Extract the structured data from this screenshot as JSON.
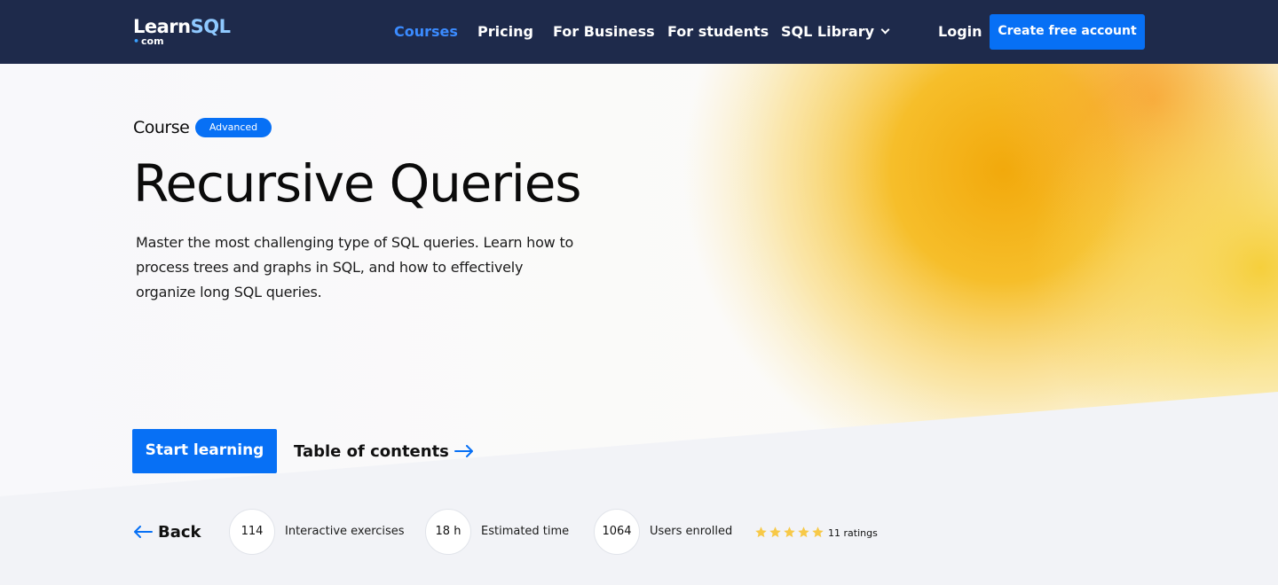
{
  "nav": {
    "logo_main": "Learn",
    "logo_accent": "SQL",
    "logo_sub": "com",
    "links": [
      {
        "label": "Courses",
        "active": true
      },
      {
        "label": "Pricing"
      },
      {
        "label": "For Business"
      },
      {
        "label": "For students"
      },
      {
        "label": "SQL Library"
      }
    ],
    "login": "Login",
    "cta": "Create free account"
  },
  "hero": {
    "eyebrow": "Course",
    "badge": "Advanced",
    "title": "Recursive Queries",
    "description": "Master the most challenging type of SQL queries. Learn how to process trees and graphs in SQL, and how to effectively organize long SQL queries.",
    "start_button": "Start learning",
    "toc_link": "Table of contents"
  },
  "stats": {
    "back": "Back",
    "items": [
      {
        "value": "114",
        "label": "Interactive exercises"
      },
      {
        "value": "18 h",
        "label": "Estimated time"
      },
      {
        "value": "1064",
        "label": "Users enrolled"
      }
    ],
    "rating_stars": 5,
    "ratings_label": "11 ratings"
  },
  "colors": {
    "nav_bg": "#1e2a4b",
    "accent": "#0770f5",
    "active_link": "#3b8bff",
    "star": "#f7c948"
  }
}
